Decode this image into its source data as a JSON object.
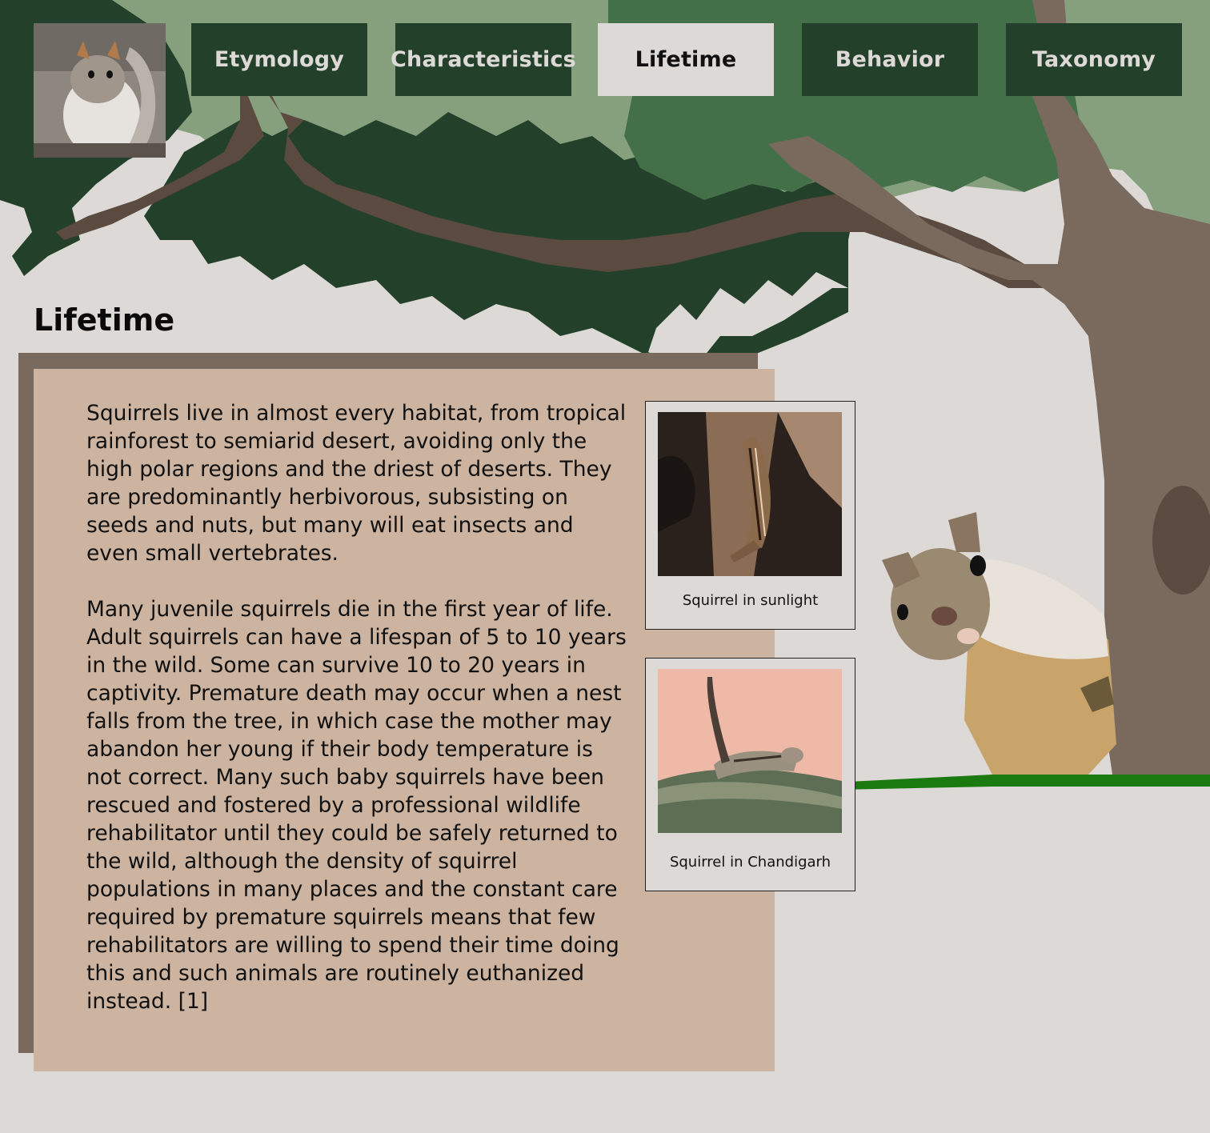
{
  "nav": {
    "logo_alt": "Squirrel portrait",
    "tabs": [
      {
        "label": "Etymology",
        "active": false
      },
      {
        "label": "Characteristics",
        "active": false
      },
      {
        "label": "Lifetime",
        "active": true
      },
      {
        "label": "Behavior",
        "active": false
      },
      {
        "label": "Taxonomy",
        "active": false
      }
    ]
  },
  "section": {
    "title": "Lifetime",
    "paragraphs": [
      "Squirrels live in almost every habitat, from tropical rainforest to semiarid desert, avoiding only the high polar regions and the driest of deserts. They are predominantly herbivorous, subsisting on seeds and nuts, but many will eat insects and even small vertebrates.",
      "Many juvenile squirrels die in the first year of life. Adult squirrels can have a lifespan of 5 to 10 years in the wild. Some can survive 10 to 20 years in captivity. Premature death may occur when a nest falls from the tree, in which case the mother may abandon her young if their body temperature is not correct. Many such baby squirrels have been rescued and fostered by a professional wildlife rehabilitator until they could be safely returned to the wild, although the density of squirrel populations in many places and the constant care required by premature squirrels means that few rehabilitators are willing to spend their time doing this and such animals are routinely euthanized instead. [1]"
    ]
  },
  "figures": [
    {
      "caption": "Squirrel in sunlight"
    },
    {
      "caption": "Squirrel in Chandigarh"
    }
  ],
  "colors": {
    "nav_background": "#23402a",
    "nav_active": "#dcd9d6",
    "page_background": "#dcd9d6",
    "panel": "#cdb4a0",
    "panel_shadow": "#7a6a5e",
    "leaves_dark": "#23402a",
    "leaves_mid": "#437049",
    "leaves_light": "#86a07e",
    "trunk": "#7a6a5e",
    "branch": "#5a4a40",
    "ground_line": "#1a7a10"
  }
}
